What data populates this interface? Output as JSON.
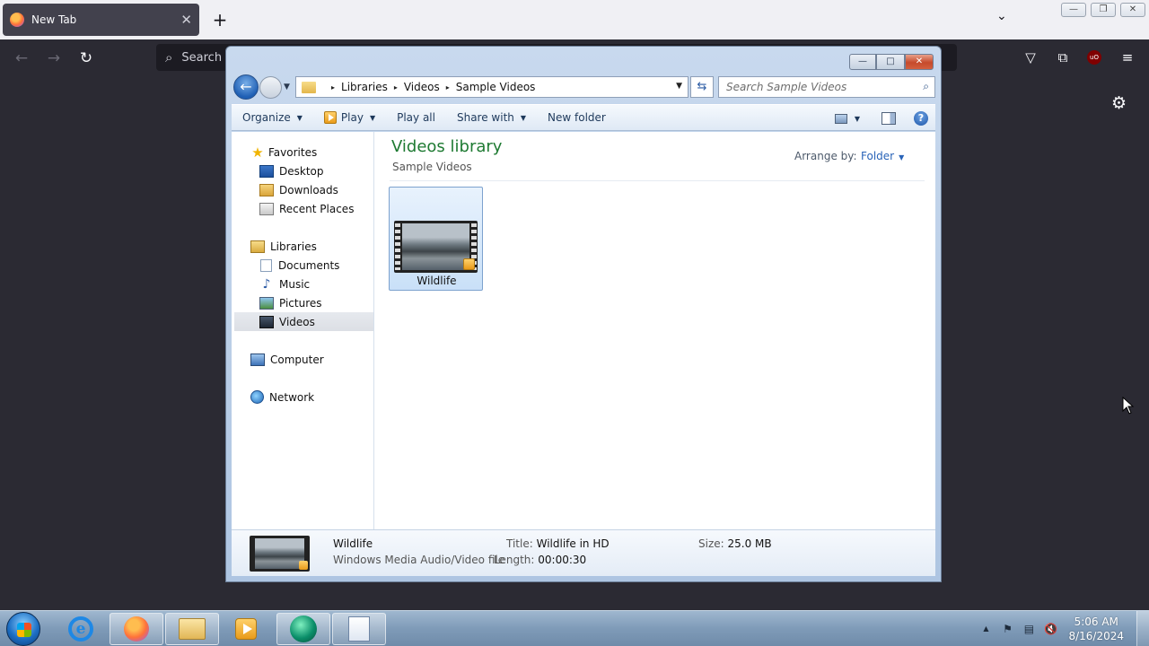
{
  "browser": {
    "tab_title": "New Tab",
    "tab_close": "✕",
    "new_tab": "+",
    "list_all_tabs": "⌄",
    "urlbar_placeholder": "Search",
    "nav": {
      "back": "←",
      "forward": "→",
      "reload": "↻"
    },
    "right_icons": {
      "pocket": "▽",
      "extensions": "⧉",
      "ublock": "uO",
      "menu": "≡"
    },
    "settings_icon": "⚙",
    "window_controls": {
      "minimize": "—",
      "restore": "❐",
      "close": "✕"
    }
  },
  "explorer": {
    "caption": {
      "minimize": "—",
      "maximize": "□",
      "close": "✕"
    },
    "breadcrumb": [
      "Libraries",
      "Videos",
      "Sample Videos"
    ],
    "breadcrumb_sep": "▸",
    "search_placeholder": "Search Sample Videos",
    "toolbar": {
      "organize": "Organize",
      "play": "Play",
      "play_all": "Play all",
      "share_with": "Share with",
      "new_folder": "New folder",
      "caret": "▼"
    },
    "nav": {
      "favorites": "Favorites",
      "desktop": "Desktop",
      "downloads": "Downloads",
      "recent_places": "Recent Places",
      "libraries": "Libraries",
      "documents": "Documents",
      "music": "Music",
      "pictures": "Pictures",
      "videos": "Videos",
      "computer": "Computer",
      "network": "Network"
    },
    "content": {
      "title": "Videos library",
      "subtitle": "Sample Videos",
      "arrange_label": "Arrange by:",
      "arrange_value": "Folder",
      "files": [
        {
          "name": "Wildlife"
        }
      ]
    },
    "details": {
      "name": "Wildlife",
      "type": "Windows Media Audio/Video file",
      "title_label": "Title:",
      "title_value": "Wildlife in HD",
      "length_label": "Length:",
      "length_value": "00:00:30",
      "size_label": "Size:",
      "size_value": "25.0 MB"
    }
  },
  "taskbar": {
    "ie_letter": "e",
    "time": "5:06 AM",
    "date": "8/16/2024",
    "tray": {
      "show_hidden": "▲",
      "flag": "⚑",
      "network": "▤",
      "volume": "🔇"
    }
  }
}
